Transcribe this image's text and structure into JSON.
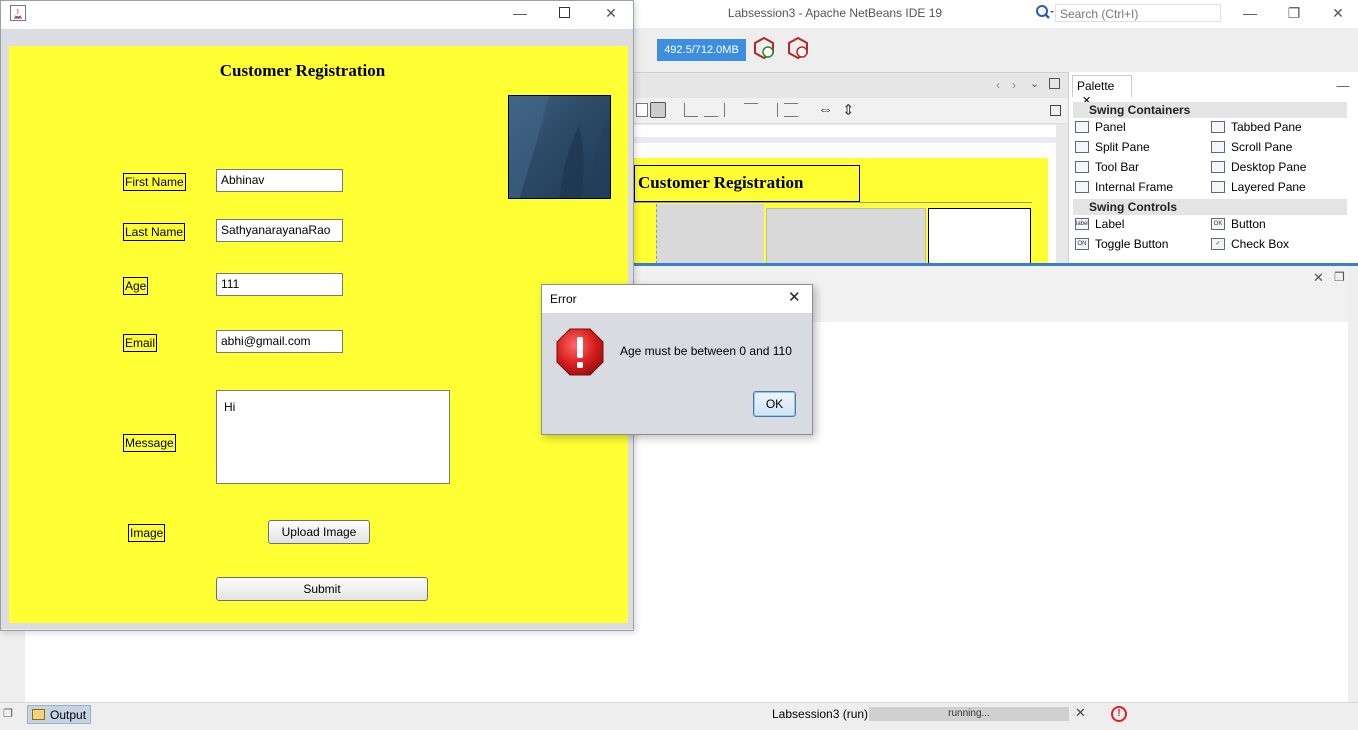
{
  "ide": {
    "title": "Labsession3 - Apache NetBeans IDE 19",
    "search_placeholder": "Search (Ctrl+I)",
    "memory": "492.5/712.0MB",
    "palette": {
      "tab": "Palette",
      "categories": [
        {
          "name": "Swing Containers",
          "items": [
            "Panel",
            "Tabbed Pane",
            "Split Pane",
            "Scroll Pane",
            "Tool Bar",
            "Desktop Pane",
            "Internal Frame",
            "Layered Pane"
          ]
        },
        {
          "name": "Swing Controls",
          "items": [
            "Label",
            "Button",
            "Toggle Button",
            "Check Box"
          ]
        }
      ]
    },
    "designer": {
      "title": "Customer Registration"
    },
    "statusbar": {
      "output_tab": "Output",
      "run_label": "Labsession3 (run)",
      "progress_text": "running..."
    },
    "colors": {
      "accent": "#3b7ed0",
      "form_bg": "#ffff33"
    }
  },
  "app": {
    "title": "Customer Registration",
    "fields": {
      "first_name": {
        "label": "First Name",
        "value": "Abhinav"
      },
      "last_name": {
        "label": "Last Name",
        "value": "SathyanarayanaRao"
      },
      "age": {
        "label": "Age",
        "value": "111"
      },
      "email": {
        "label": "Email",
        "value": "abhi@gmail.com"
      },
      "message": {
        "label": "Message",
        "value": "Hi"
      },
      "image": {
        "label": "Image"
      }
    },
    "buttons": {
      "upload": "Upload Image",
      "submit": "Submit"
    }
  },
  "dialog": {
    "title": "Error",
    "message": "Age must be between 0 and 110",
    "ok": "OK",
    "icon": "error-icon"
  }
}
